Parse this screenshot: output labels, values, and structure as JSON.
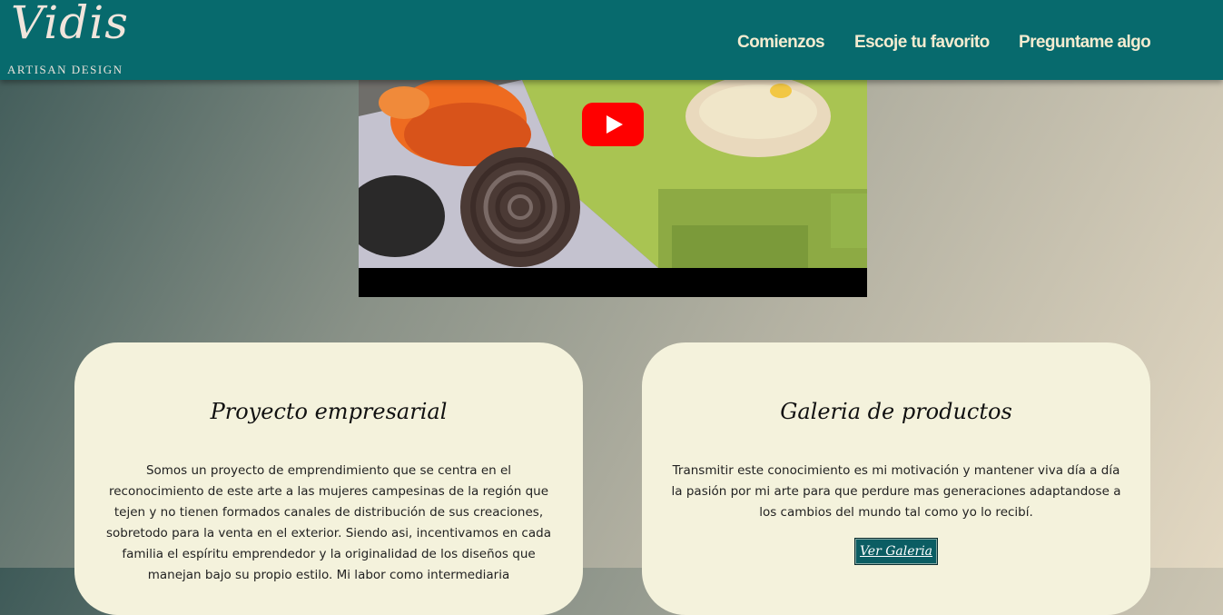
{
  "brand": {
    "name": "Vidis",
    "tagline": "ARTISAN DESIGN"
  },
  "nav": {
    "items": [
      {
        "label": "Comienzos"
      },
      {
        "label": "Escoje tu favorito"
      },
      {
        "label": "Preguntame algo"
      }
    ]
  },
  "video": {
    "play_icon": "play-icon"
  },
  "cards": [
    {
      "title": "Proyecto empresarial",
      "text": "Somos un proyecto de emprendimiento que se centra en el reconocimiento de este arte a las mujeres campesinas de la región que tejen y no tienen formados canales de distribución de sus creaciones, sobretodo para la venta en el exterior. Siendo asi, incentivamos en cada familia el espíritu emprendedor y la originalidad de los diseños que manejan bajo su propio estilo. Mi labor como intermediaria"
    },
    {
      "title": "Galeria de productos",
      "text": "Transmitir este conocimiento es mi motivación y mantener viva día a día la pasión por mi arte para que perdure mas generaciones adaptandose a los cambios del mundo tal como yo lo recibí.",
      "button_label": "Ver Galeria"
    }
  ],
  "colors": {
    "navbar": "#076a6d",
    "card": "#f4f2dc",
    "button": "#0b5d63"
  }
}
